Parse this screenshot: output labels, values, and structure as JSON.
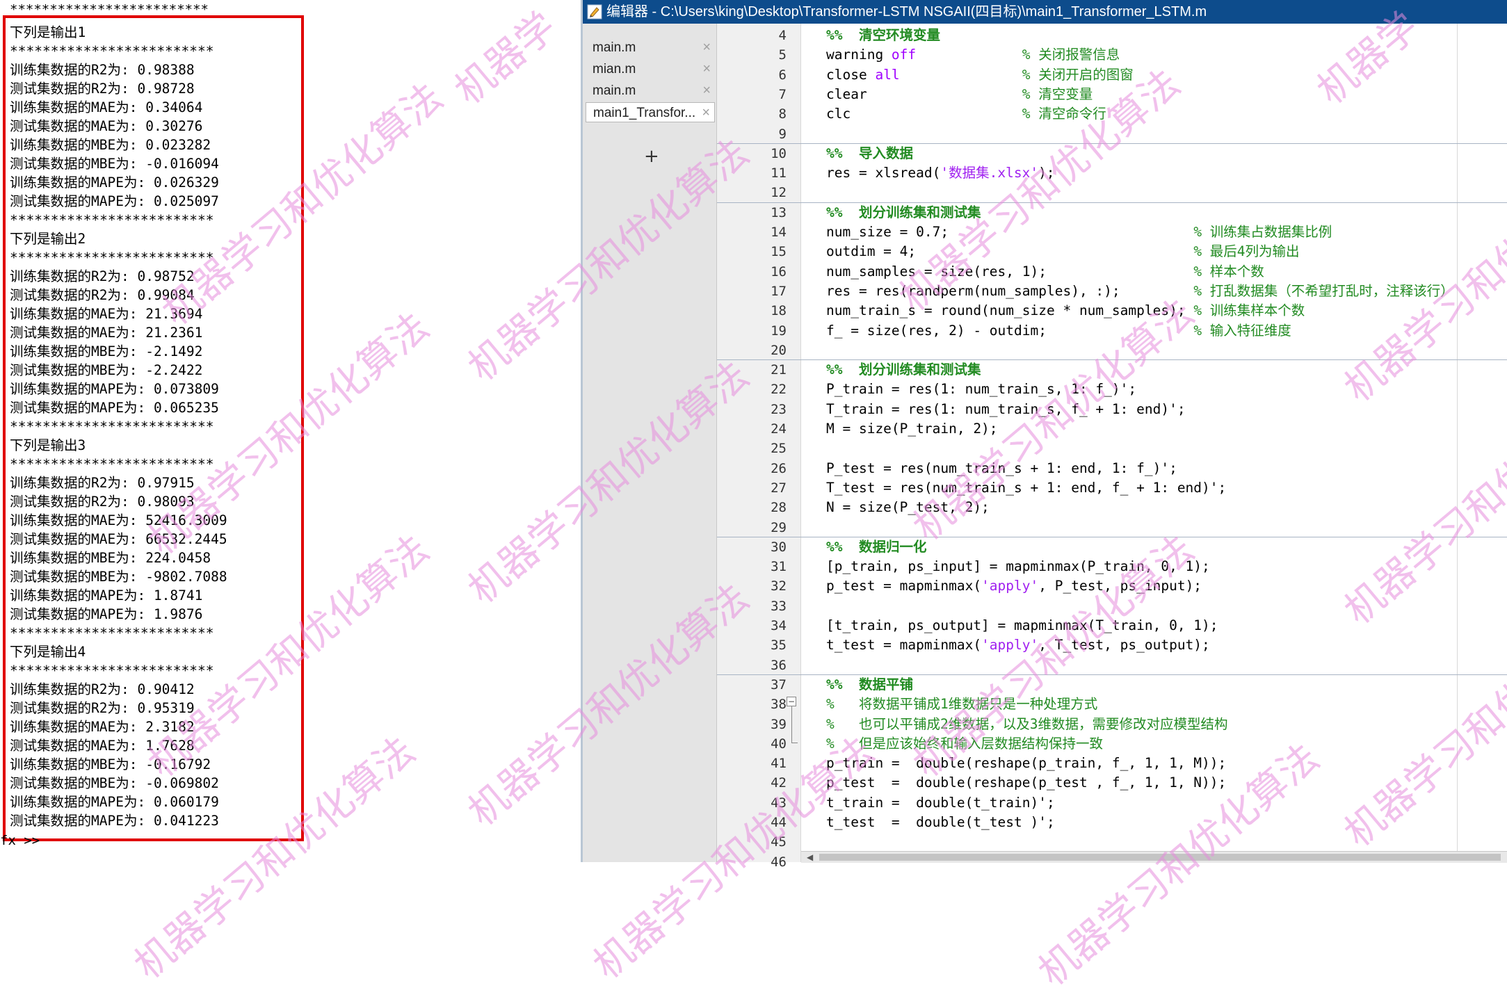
{
  "command_window": {
    "top_stars": "*************************",
    "lines": [
      "下列是输出1",
      "*************************",
      "训练集数据的R2为: 0.98388",
      "测试集数据的R2为: 0.98728",
      "训练集数据的MAE为: 0.34064",
      "测试集数据的MAE为: 0.30276",
      "训练集数据的MBE为: 0.023282",
      "测试集数据的MBE为: -0.016094",
      "训练集数据的MAPE为: 0.026329",
      "测试集数据的MAPE为: 0.025097",
      "*************************",
      "下列是输出2",
      "*************************",
      "训练集数据的R2为: 0.98752",
      "测试集数据的R2为: 0.99084",
      "训练集数据的MAE为: 21.3694",
      "测试集数据的MAE为: 21.2361",
      "训练集数据的MBE为: -2.1492",
      "测试集数据的MBE为: -2.2422",
      "训练集数据的MAPE为: 0.073809",
      "测试集数据的MAPE为: 0.065235",
      "*************************",
      "下列是输出3",
      "*************************",
      "训练集数据的R2为: 0.97915",
      "测试集数据的R2为: 0.98093",
      "训练集数据的MAE为: 52416.3009",
      "测试集数据的MAE为: 66532.2445",
      "训练集数据的MBE为: 224.0458",
      "测试集数据的MBE为: -9802.7088",
      "训练集数据的MAPE为: 1.8741",
      "测试集数据的MAPE为: 1.9876",
      "*************************",
      "下列是输出4",
      "*************************",
      "训练集数据的R2为: 0.90412",
      "测试集数据的R2为: 0.95319",
      "训练集数据的MAE为: 2.3182",
      "测试集数据的MAE为: 1.7628",
      "训练集数据的MBE为: -0.16792",
      "测试集数据的MBE为: -0.069802",
      "训练集数据的MAPE为: 0.060179",
      "测试集数据的MAPE为: 0.041223"
    ],
    "prompt": "fx >>"
  },
  "editor": {
    "title": "编辑器 - C:\\Users\\king\\Desktop\\Transformer-LSTM NSGAII(四目标)\\main1_Transformer_LSTM.m",
    "tabs": [
      {
        "label": "main.m",
        "close": "×"
      },
      {
        "label": "mian.m",
        "close": "×"
      },
      {
        "label": "main.m",
        "close": "×"
      },
      {
        "label": "main1_Transfor...",
        "close": "×"
      }
    ],
    "add_tab": "+",
    "code_lines": [
      {
        "n": "4",
        "code": "%%  清空环境变量"
      },
      {
        "n": "5",
        "code": "warning off             % 关闭报警信息"
      },
      {
        "n": "6",
        "code": "close all               % 关闭开启的图窗"
      },
      {
        "n": "7",
        "code": "clear                   % 清空变量"
      },
      {
        "n": "8",
        "code": "clc                     % 清空命令行"
      },
      {
        "n": "9",
        "code": ""
      },
      {
        "n": "10",
        "code": "%%  导入数据"
      },
      {
        "n": "11",
        "code": "res = xlsread('数据集.xlsx');"
      },
      {
        "n": "12",
        "code": ""
      },
      {
        "n": "13",
        "code": "%%  划分训练集和测试集"
      },
      {
        "n": "14",
        "code": "num_size = 0.7;                              % 训练集占数据集比例"
      },
      {
        "n": "15",
        "code": "outdim = 4;                                  % 最后4列为输出"
      },
      {
        "n": "16",
        "code": "num_samples = size(res, 1);                  % 样本个数"
      },
      {
        "n": "17",
        "code": "res = res(randperm(num_samples), :);         % 打乱数据集（不希望打乱时，注释该行）"
      },
      {
        "n": "18",
        "code": "num_train_s = round(num_size * num_samples); % 训练集样本个数"
      },
      {
        "n": "19",
        "code": "f_ = size(res, 2) - outdim;                  % 输入特征维度"
      },
      {
        "n": "20",
        "code": ""
      },
      {
        "n": "21",
        "code": "%%  划分训练集和测试集"
      },
      {
        "n": "22",
        "code": "P_train = res(1: num_train_s, 1: f_)';"
      },
      {
        "n": "23",
        "code": "T_train = res(1: num_train_s, f_ + 1: end)';"
      },
      {
        "n": "24",
        "code": "M = size(P_train, 2);"
      },
      {
        "n": "25",
        "code": ""
      },
      {
        "n": "26",
        "code": "P_test = res(num_train_s + 1: end, 1: f_)';"
      },
      {
        "n": "27",
        "code": "T_test = res(num_train_s + 1: end, f_ + 1: end)';"
      },
      {
        "n": "28",
        "code": "N = size(P_test, 2);"
      },
      {
        "n": "29",
        "code": ""
      },
      {
        "n": "30",
        "code": "%%  数据归一化"
      },
      {
        "n": "31",
        "code": "[p_train, ps_input] = mapminmax(P_train, 0, 1);"
      },
      {
        "n": "32",
        "code": "p_test = mapminmax('apply', P_test, ps_input);"
      },
      {
        "n": "33",
        "code": ""
      },
      {
        "n": "34",
        "code": "[t_train, ps_output] = mapminmax(T_train, 0, 1);"
      },
      {
        "n": "35",
        "code": "t_test = mapminmax('apply', T_test, ps_output);"
      },
      {
        "n": "36",
        "code": ""
      },
      {
        "n": "37",
        "code": "%%  数据平铺"
      },
      {
        "n": "38",
        "code": "%   将数据平铺成1维数据只是一种处理方式"
      },
      {
        "n": "39",
        "code": "%   也可以平铺成2维数据，以及3维数据，需要修改对应模型结构"
      },
      {
        "n": "40",
        "code": "%   但是应该始终和输入层数据结构保持一致"
      },
      {
        "n": "41",
        "code": "p_train =  double(reshape(p_train, f_, 1, 1, M));"
      },
      {
        "n": "42",
        "code": "p_test  =  double(reshape(p_test , f_, 1, 1, N));"
      },
      {
        "n": "43",
        "code": "t_train =  double(t_train)';"
      },
      {
        "n": "44",
        "code": "t_test  =  double(t_test )';"
      },
      {
        "n": "45",
        "code": ""
      },
      {
        "n": "46",
        "code": ""
      }
    ]
  },
  "watermark": {
    "text_a": "机器学习和优化算法",
    "text_b": "机器学",
    "color": "#e68cdc"
  },
  "colors": {
    "title_bar": "#0d4c8c",
    "highlight_box": "#e00000",
    "comment": "#228B22",
    "string": "#a020f0"
  }
}
